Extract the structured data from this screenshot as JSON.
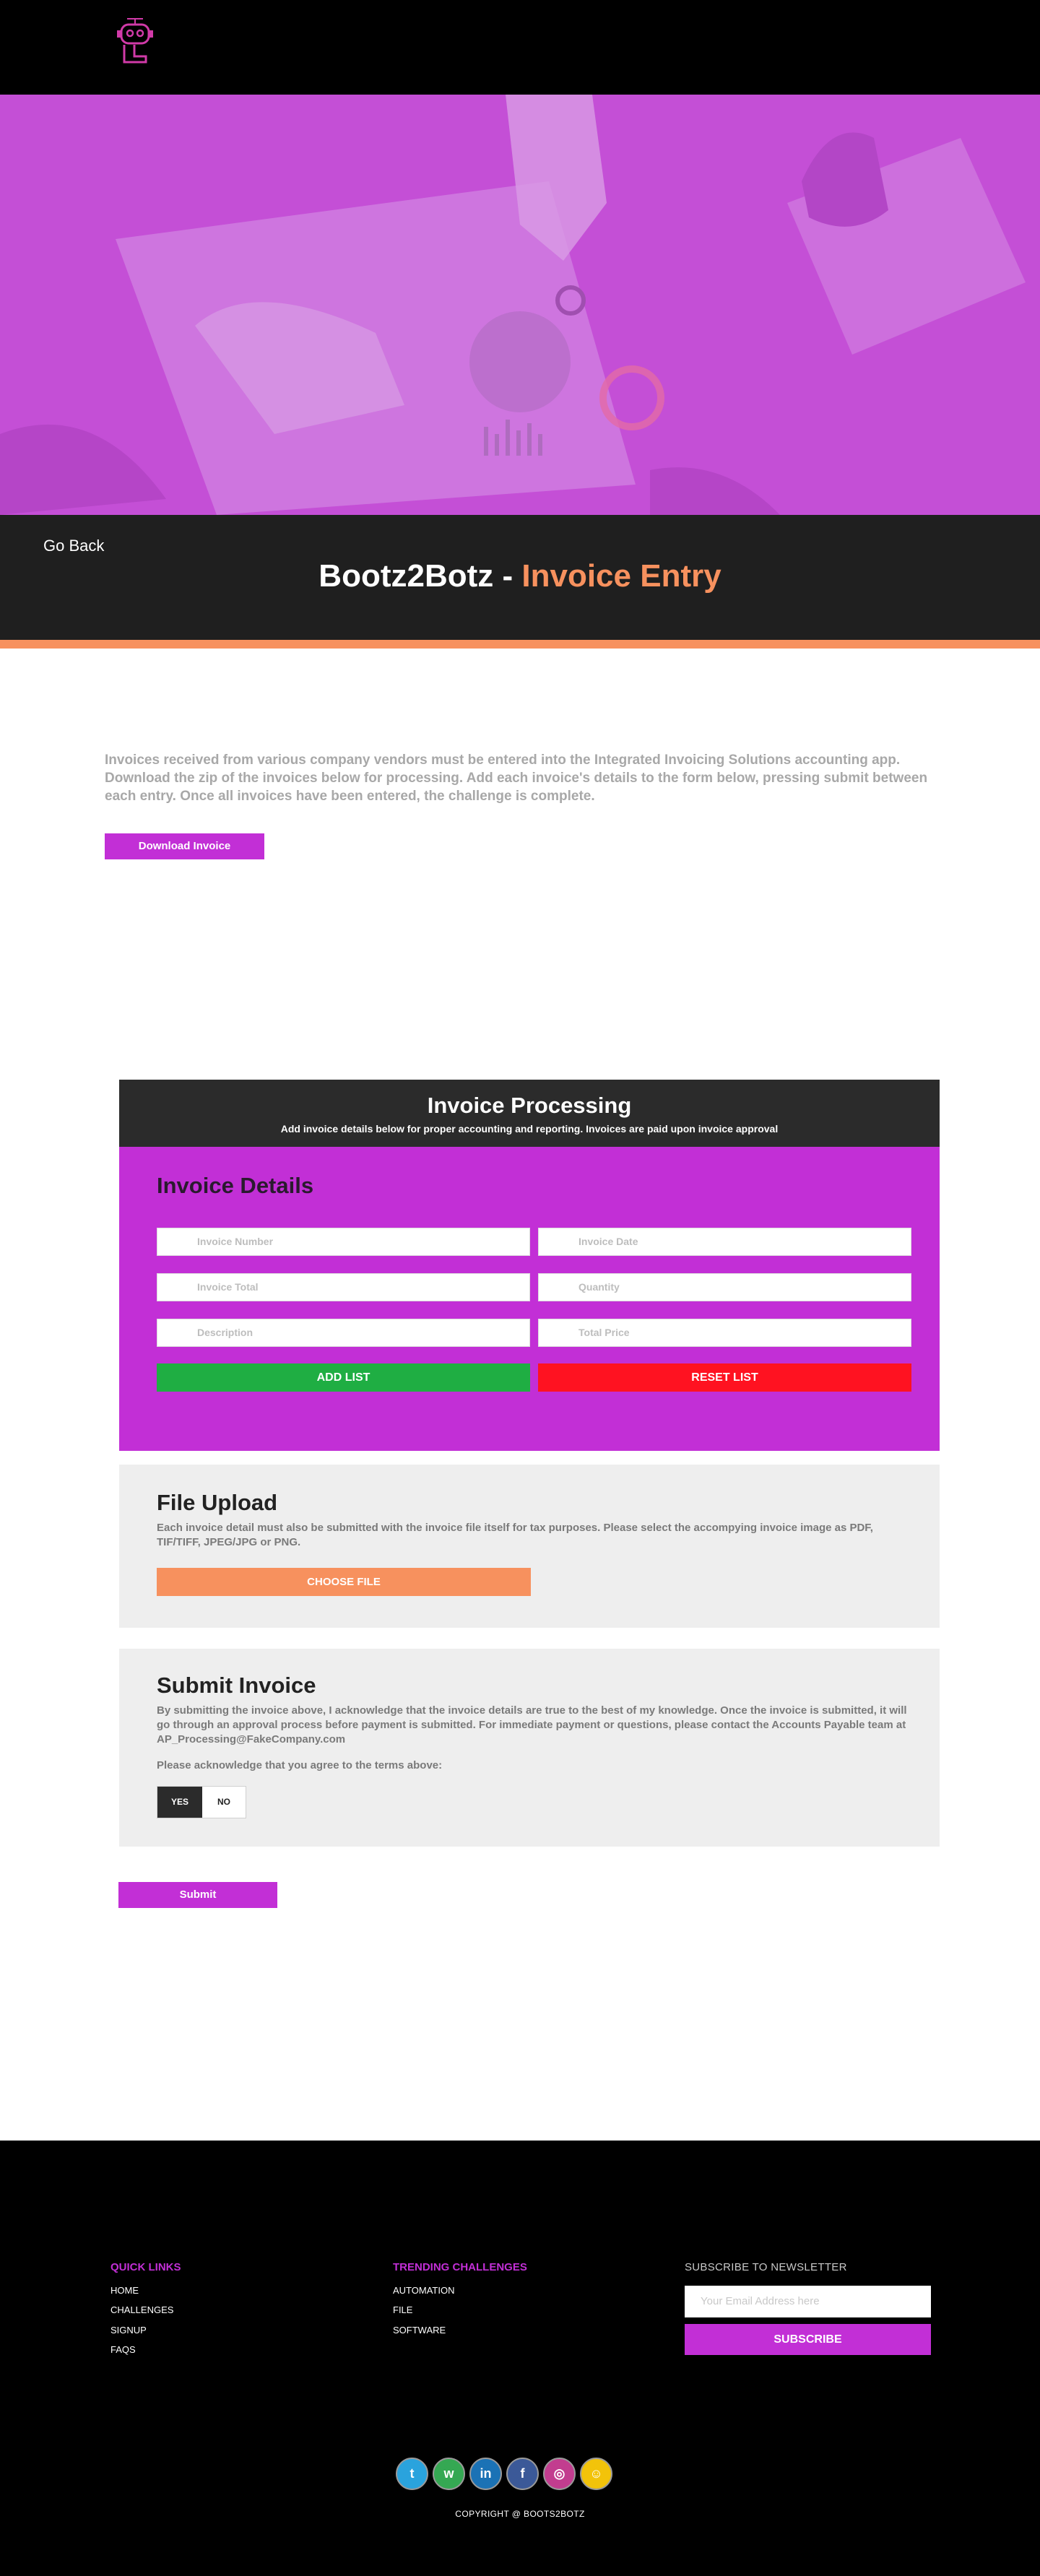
{
  "nav": {
    "signup": "SIGNUP",
    "challenges": "CHALLENGES"
  },
  "header": {
    "goback": "Go Back",
    "title_main": "Bootz2Botz",
    "title_sep": " - ",
    "title_accent": "Invoice Entry"
  },
  "intro": {
    "text": "Invoices received from various company vendors must be entered into the Integrated Invoicing Solutions accounting app. Download the zip of the invoices below for processing. Add each invoice's details to the form below, pressing submit between each entry. Once all invoices have been entered, the challenge is complete.",
    "download_label": "Download Invoice"
  },
  "processing": {
    "title": "Invoice Processing",
    "subtitle": "Add invoice details below for proper accounting and reporting. Invoices are paid upon invoice approval"
  },
  "details": {
    "title": "Invoice Details",
    "fields": {
      "invoice_number": "Invoice Number",
      "invoice_date": "Invoice Date",
      "invoice_total": "Invoice Total",
      "quantity": "Quantity",
      "description": "Description",
      "total_price": "Total Price"
    },
    "add_label": "ADD LIST",
    "reset_label": "RESET LIST"
  },
  "upload": {
    "title": "File Upload",
    "text": "Each invoice detail must also be submitted with the invoice file itself for tax purposes. Please select the accompying invoice image as PDF, TIF/TIFF, JPEG/JPG or PNG.",
    "choose_label": "CHOOSE FILE"
  },
  "submit": {
    "title": "Submit Invoice",
    "terms": "By submitting the invoice above, I acknowledge that the invoice details are true to the best of my knowledge. Once the invoice is submitted, it will go through an approval process before payment is submitted. For immediate payment or questions, please contact the Accounts Payable team at AP_Processing@FakeCompany.com",
    "ack": "Please acknowledge that you agree to the terms above:",
    "yes": "YES",
    "no": "NO",
    "button": "Submit"
  },
  "footer": {
    "quick_links_title": "QUICK LINKS",
    "quick_links": [
      "HOME",
      "CHALLENGES",
      "SIGNUP",
      "FAQS"
    ],
    "trending_title": "TRENDING CHALLENGES",
    "trending": [
      "AUTOMATION",
      "FILE",
      "SOFTWARE"
    ],
    "newsletter_title": "SUBSCRIBE TO NEWSLETTER",
    "newsletter_placeholder": "Your Email Address here",
    "subscribe_label": "SUBSCRIBE",
    "socials": [
      {
        "name": "twitter-icon",
        "glyph": "t",
        "color": "#2aa3dd"
      },
      {
        "name": "whatsapp-icon",
        "glyph": "w",
        "color": "#35a853"
      },
      {
        "name": "linkedin-icon",
        "glyph": "in",
        "color": "#1b72b5"
      },
      {
        "name": "facebook-icon",
        "glyph": "f",
        "color": "#3b5998"
      },
      {
        "name": "instagram-icon",
        "glyph": "◎",
        "color": "#c23d8f"
      },
      {
        "name": "snapchat-icon",
        "glyph": "☺",
        "color": "#f2c30a"
      }
    ],
    "copyright": "COPYRIGHT @  BOOTS2BOTZ"
  },
  "colors": {
    "brand": "#c22fd6",
    "accent": "#f7915e",
    "green": "#1fae43",
    "red": "#ff1221"
  }
}
